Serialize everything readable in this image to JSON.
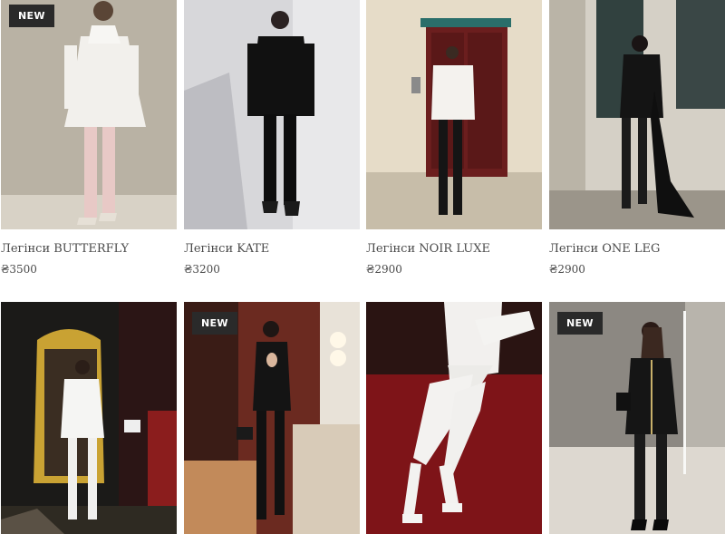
{
  "products": [
    {
      "name": "Легінси BUTTERFLY",
      "price": "₴3500",
      "badge": "NEW"
    },
    {
      "name": "Легінси KATE",
      "price": "₴3200",
      "badge": ""
    },
    {
      "name": "Легінси NOIR LUXE",
      "price": "₴2900",
      "badge": ""
    },
    {
      "name": "Легінси ONE LEG",
      "price": "₴2900",
      "badge": ""
    },
    {
      "name": "",
      "price": "",
      "badge": ""
    },
    {
      "name": "",
      "price": "",
      "badge": "NEW"
    },
    {
      "name": "",
      "price": "",
      "badge": ""
    },
    {
      "name": "",
      "price": "",
      "badge": "NEW"
    }
  ],
  "colors": {
    "badge_bg": "#2a2a2a",
    "badge_text": "#ffffff",
    "text": "#4a4a4a"
  }
}
